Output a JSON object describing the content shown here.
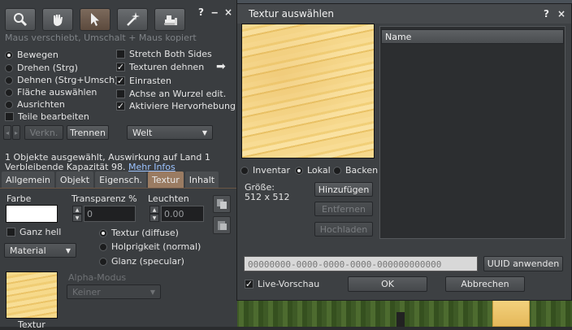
{
  "build": {
    "hint": "Maus verschiebt, Umschalt + Maus kopiert",
    "controls": {
      "help": "?",
      "minimize": "‒",
      "close": "×"
    },
    "tool_icons": [
      "magnifier-icon",
      "hand-grab-icon",
      "pointer-icon",
      "magic-wand-icon",
      "bulldozer-icon"
    ],
    "modes": [
      {
        "label": "Bewegen",
        "selected": true
      },
      {
        "label": "Drehen (Strg)",
        "selected": false
      },
      {
        "label": "Dehnen (Strg+Umsch)",
        "selected": false
      },
      {
        "label": "Fläche auswählen",
        "selected": false
      },
      {
        "label": "Ausrichten",
        "selected": false
      }
    ],
    "edit_parts": "Teile bearbeiten",
    "options": [
      {
        "label": "Stretch Both Sides",
        "checked": false
      },
      {
        "label": "Texturen dehnen",
        "checked": true
      },
      {
        "label": "Einrasten",
        "checked": true
      },
      {
        "label": "Achse an Wurzel edit.",
        "checked": false
      },
      {
        "label": "Aktiviere Hervorhebung",
        "checked": true
      }
    ],
    "link_label": "Verkn.",
    "unlink_label": "Trennen",
    "ruler_value": "Welt",
    "info_line1": "1 Objekte ausgewählt, Auswirkung auf Land 1",
    "info_line2": "Verbleibende Kapazität 98.",
    "more_info": "Mehr Infos",
    "tabs": [
      "Allgemein",
      "Objekt",
      "Eigensch.",
      "Textur",
      "Inhalt"
    ],
    "active_tab": "Textur",
    "texture_panel": {
      "color_label": "Farbe",
      "transparency_label": "Transparenz %",
      "transparency_value": "0",
      "glow_label": "Leuchten",
      "glow_value": "0.00",
      "fullbright": "Ganz hell",
      "material_value": "Material",
      "maps": [
        {
          "label": "Textur (diffuse)",
          "selected": true
        },
        {
          "label": "Holprigkeit (normal)",
          "selected": false
        },
        {
          "label": "Glanz (specular)",
          "selected": false
        }
      ],
      "alpha_label": "Alpha-Modus",
      "alpha_value": "Keiner",
      "texture_caption": "Textur"
    }
  },
  "picker": {
    "title": "Textur auswählen",
    "controls": {
      "help": "?",
      "close": "×"
    },
    "sources": [
      {
        "label": "Inventar",
        "selected": false
      },
      {
        "label": "Lokal",
        "selected": true
      },
      {
        "label": "Backen",
        "selected": false
      }
    ],
    "size_label": "Größe:",
    "size_value": "512 x 512",
    "add_button": "Hinzufügen",
    "remove_button": "Entfernen",
    "upload_button": "Hochladen",
    "list_header": "Name",
    "uuid_value": "00000000-0000-0000-0000-000000000000",
    "apply_uuid": "UUID anwenden",
    "live_preview": "Live-Vorschau",
    "live_preview_checked": true,
    "ok": "OK",
    "cancel": "Abbrechen"
  }
}
